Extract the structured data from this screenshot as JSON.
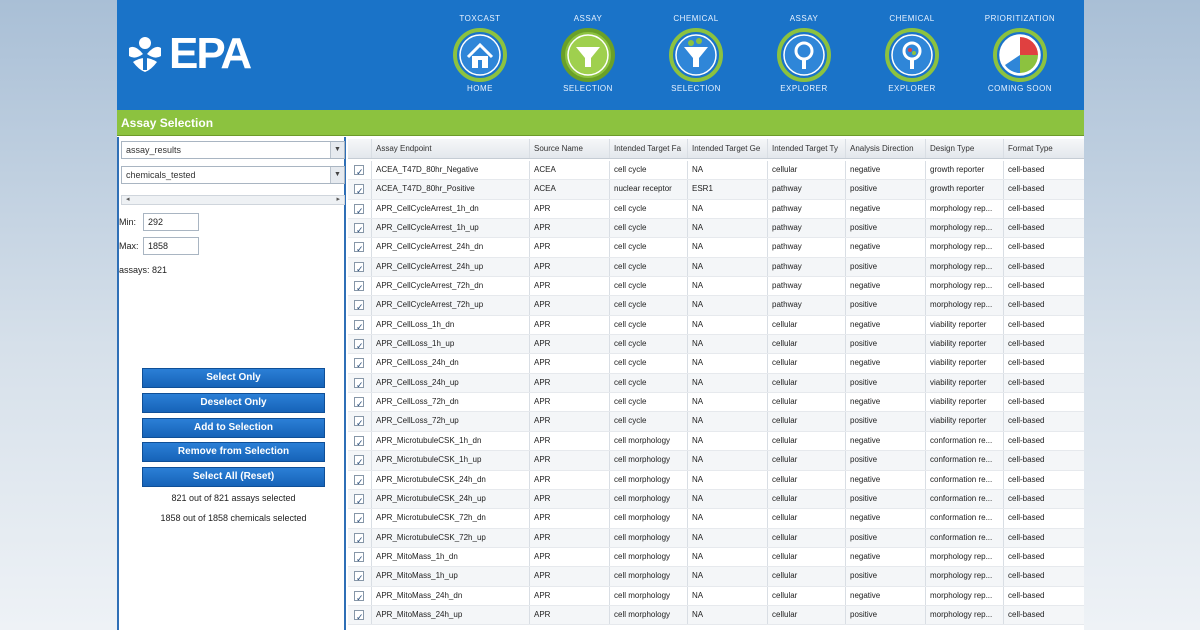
{
  "logo": {
    "text": "EPA"
  },
  "nav": [
    {
      "top": "TOXCAST",
      "bottom": "HOME",
      "icon": "house-icon"
    },
    {
      "top": "ASSAY",
      "bottom": "SELECTION",
      "icon": "funnel-icon"
    },
    {
      "top": "CHEMICAL",
      "bottom": "SELECTION",
      "icon": "chemical-funnel-icon"
    },
    {
      "top": "ASSAY",
      "bottom": "EXPLORER",
      "icon": "assay-magnifier-icon"
    },
    {
      "top": "CHEMICAL",
      "bottom": "EXPLORER",
      "icon": "chemical-magnifier-icon"
    },
    {
      "top": "PRIORITIZATION",
      "bottom": "COMING SOON",
      "icon": "pie-chart-icon"
    }
  ],
  "title": "Assay Selection",
  "left": {
    "select1": "assay_results",
    "select2": "chemicals_tested",
    "min_label": "Min:",
    "min_value": "292",
    "max_label": "Max:",
    "max_value": "1858",
    "assays_count": "assays: 821",
    "buttons": [
      "Select Only",
      "Deselect Only",
      "Add to Selection",
      "Remove from Selection",
      "Select All (Reset)"
    ],
    "status1": "821 out of 821 assays selected",
    "status2": "1858 out of 1858 chemicals selected"
  },
  "table": {
    "headers": [
      "Assay Endpoint",
      "Source Name",
      "Intended Target Fa",
      "Intended Target Ge",
      "Intended Target Ty",
      "Analysis Direction",
      "Design Type",
      "Format Type"
    ],
    "rows": [
      [
        "ACEA_T47D_80hr_Negative",
        "ACEA",
        "cell cycle",
        "NA",
        "cellular",
        "negative",
        "growth reporter",
        "cell-based"
      ],
      [
        "ACEA_T47D_80hr_Positive",
        "ACEA",
        "nuclear receptor",
        "ESR1",
        "pathway",
        "positive",
        "growth reporter",
        "cell-based"
      ],
      [
        "APR_CellCycleArrest_1h_dn",
        "APR",
        "cell cycle",
        "NA",
        "pathway",
        "negative",
        "morphology rep...",
        "cell-based"
      ],
      [
        "APR_CellCycleArrest_1h_up",
        "APR",
        "cell cycle",
        "NA",
        "pathway",
        "positive",
        "morphology rep...",
        "cell-based"
      ],
      [
        "APR_CellCycleArrest_24h_dn",
        "APR",
        "cell cycle",
        "NA",
        "pathway",
        "negative",
        "morphology rep...",
        "cell-based"
      ],
      [
        "APR_CellCycleArrest_24h_up",
        "APR",
        "cell cycle",
        "NA",
        "pathway",
        "positive",
        "morphology rep...",
        "cell-based"
      ],
      [
        "APR_CellCycleArrest_72h_dn",
        "APR",
        "cell cycle",
        "NA",
        "pathway",
        "negative",
        "morphology rep...",
        "cell-based"
      ],
      [
        "APR_CellCycleArrest_72h_up",
        "APR",
        "cell cycle",
        "NA",
        "pathway",
        "positive",
        "morphology rep...",
        "cell-based"
      ],
      [
        "APR_CellLoss_1h_dn",
        "APR",
        "cell cycle",
        "NA",
        "cellular",
        "negative",
        "viability reporter",
        "cell-based"
      ],
      [
        "APR_CellLoss_1h_up",
        "APR",
        "cell cycle",
        "NA",
        "cellular",
        "positive",
        "viability reporter",
        "cell-based"
      ],
      [
        "APR_CellLoss_24h_dn",
        "APR",
        "cell cycle",
        "NA",
        "cellular",
        "negative",
        "viability reporter",
        "cell-based"
      ],
      [
        "APR_CellLoss_24h_up",
        "APR",
        "cell cycle",
        "NA",
        "cellular",
        "positive",
        "viability reporter",
        "cell-based"
      ],
      [
        "APR_CellLoss_72h_dn",
        "APR",
        "cell cycle",
        "NA",
        "cellular",
        "negative",
        "viability reporter",
        "cell-based"
      ],
      [
        "APR_CellLoss_72h_up",
        "APR",
        "cell cycle",
        "NA",
        "cellular",
        "positive",
        "viability reporter",
        "cell-based"
      ],
      [
        "APR_MicrotubuleCSK_1h_dn",
        "APR",
        "cell morphology",
        "NA",
        "cellular",
        "negative",
        "conformation re...",
        "cell-based"
      ],
      [
        "APR_MicrotubuleCSK_1h_up",
        "APR",
        "cell morphology",
        "NA",
        "cellular",
        "positive",
        "conformation re...",
        "cell-based"
      ],
      [
        "APR_MicrotubuleCSK_24h_dn",
        "APR",
        "cell morphology",
        "NA",
        "cellular",
        "negative",
        "conformation re...",
        "cell-based"
      ],
      [
        "APR_MicrotubuleCSK_24h_up",
        "APR",
        "cell morphology",
        "NA",
        "cellular",
        "positive",
        "conformation re...",
        "cell-based"
      ],
      [
        "APR_MicrotubuleCSK_72h_dn",
        "APR",
        "cell morphology",
        "NA",
        "cellular",
        "negative",
        "conformation re...",
        "cell-based"
      ],
      [
        "APR_MicrotubuleCSK_72h_up",
        "APR",
        "cell morphology",
        "NA",
        "cellular",
        "positive",
        "conformation re...",
        "cell-based"
      ],
      [
        "APR_MitoMass_1h_dn",
        "APR",
        "cell morphology",
        "NA",
        "cellular",
        "negative",
        "morphology rep...",
        "cell-based"
      ],
      [
        "APR_MitoMass_1h_up",
        "APR",
        "cell morphology",
        "NA",
        "cellular",
        "positive",
        "morphology rep...",
        "cell-based"
      ],
      [
        "APR_MitoMass_24h_dn",
        "APR",
        "cell morphology",
        "NA",
        "cellular",
        "negative",
        "morphology rep...",
        "cell-based"
      ],
      [
        "APR_MitoMass_24h_up",
        "APR",
        "cell morphology",
        "NA",
        "cellular",
        "positive",
        "morphology rep...",
        "cell-based"
      ]
    ]
  },
  "colors": {
    "header_blue": "#1a73c8",
    "title_green": "#8cc23f",
    "button_blue": "#1663b8",
    "nav_ring": "#8cc23f"
  }
}
